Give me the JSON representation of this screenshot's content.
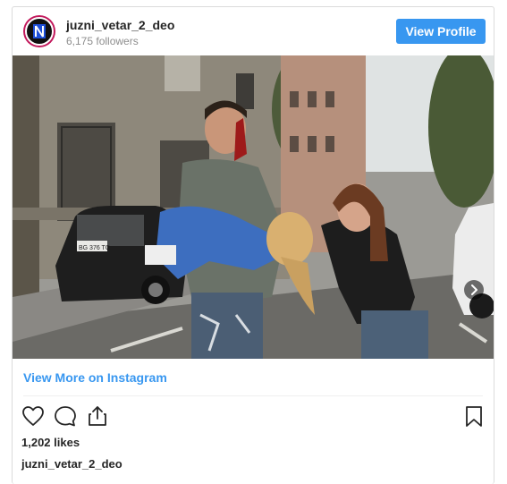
{
  "post": {
    "username": "juzni_vetar_2_deo",
    "followers": "6,175 followers",
    "view_profile_label": "View Profile",
    "view_more_label": "View More on Instagram",
    "likes": "1,202 likes",
    "caption_username": "juzni_vetar_2_deo",
    "license_plate": "BG 376 TC"
  },
  "colors": {
    "accent": "#3897f0",
    "border": "#dbdbdb",
    "text": "#262626",
    "muted": "#8e8e8e"
  },
  "icons": {
    "like": "heart-outline-icon",
    "comment": "comment-bubble-icon",
    "share": "share-upload-icon",
    "save": "bookmark-icon",
    "next": "chevron-right-icon"
  }
}
